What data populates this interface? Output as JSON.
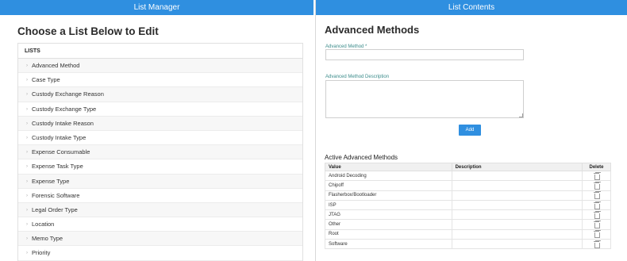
{
  "left_panel": {
    "header": "List Manager",
    "title": "Choose a List Below to Edit",
    "lists_header": "LISTS",
    "items": [
      {
        "label": "Advanced Method"
      },
      {
        "label": "Case Type"
      },
      {
        "label": "Custody Exchange Reason"
      },
      {
        "label": "Custody Exchange Type"
      },
      {
        "label": "Custody Intake Reason"
      },
      {
        "label": "Custody Intake Type"
      },
      {
        "label": "Expense Consumable"
      },
      {
        "label": "Expense Task Type"
      },
      {
        "label": "Expense Type"
      },
      {
        "label": "Forensic Software"
      },
      {
        "label": "Legal Order Type"
      },
      {
        "label": "Location"
      },
      {
        "label": "Memo Type"
      },
      {
        "label": "Priority"
      }
    ]
  },
  "right_panel": {
    "header": "List Contents",
    "title": "Advanced Methods",
    "method_label": "Advanced Method *",
    "method_value": "",
    "description_label": "Advanced Method Description",
    "description_value": "",
    "add_label": "Add",
    "active_title": "Active Advanced Methods",
    "columns": {
      "value": "Value",
      "description": "Description",
      "delete": "Delete"
    },
    "rows": [
      {
        "value": "Android Decoding",
        "description": ""
      },
      {
        "value": "Chipoff",
        "description": ""
      },
      {
        "value": "Flasherbox/Bootloader",
        "description": ""
      },
      {
        "value": "ISP",
        "description": ""
      },
      {
        "value": "JTAG",
        "description": ""
      },
      {
        "value": "Other",
        "description": ""
      },
      {
        "value": "Root",
        "description": ""
      },
      {
        "value": "Software",
        "description": ""
      }
    ]
  },
  "colors": {
    "accent": "#2f8fe0",
    "label": "#3a8b8a"
  },
  "icons": {
    "row_chevron": "chevron-right-icon",
    "delete": "trash-icon"
  }
}
